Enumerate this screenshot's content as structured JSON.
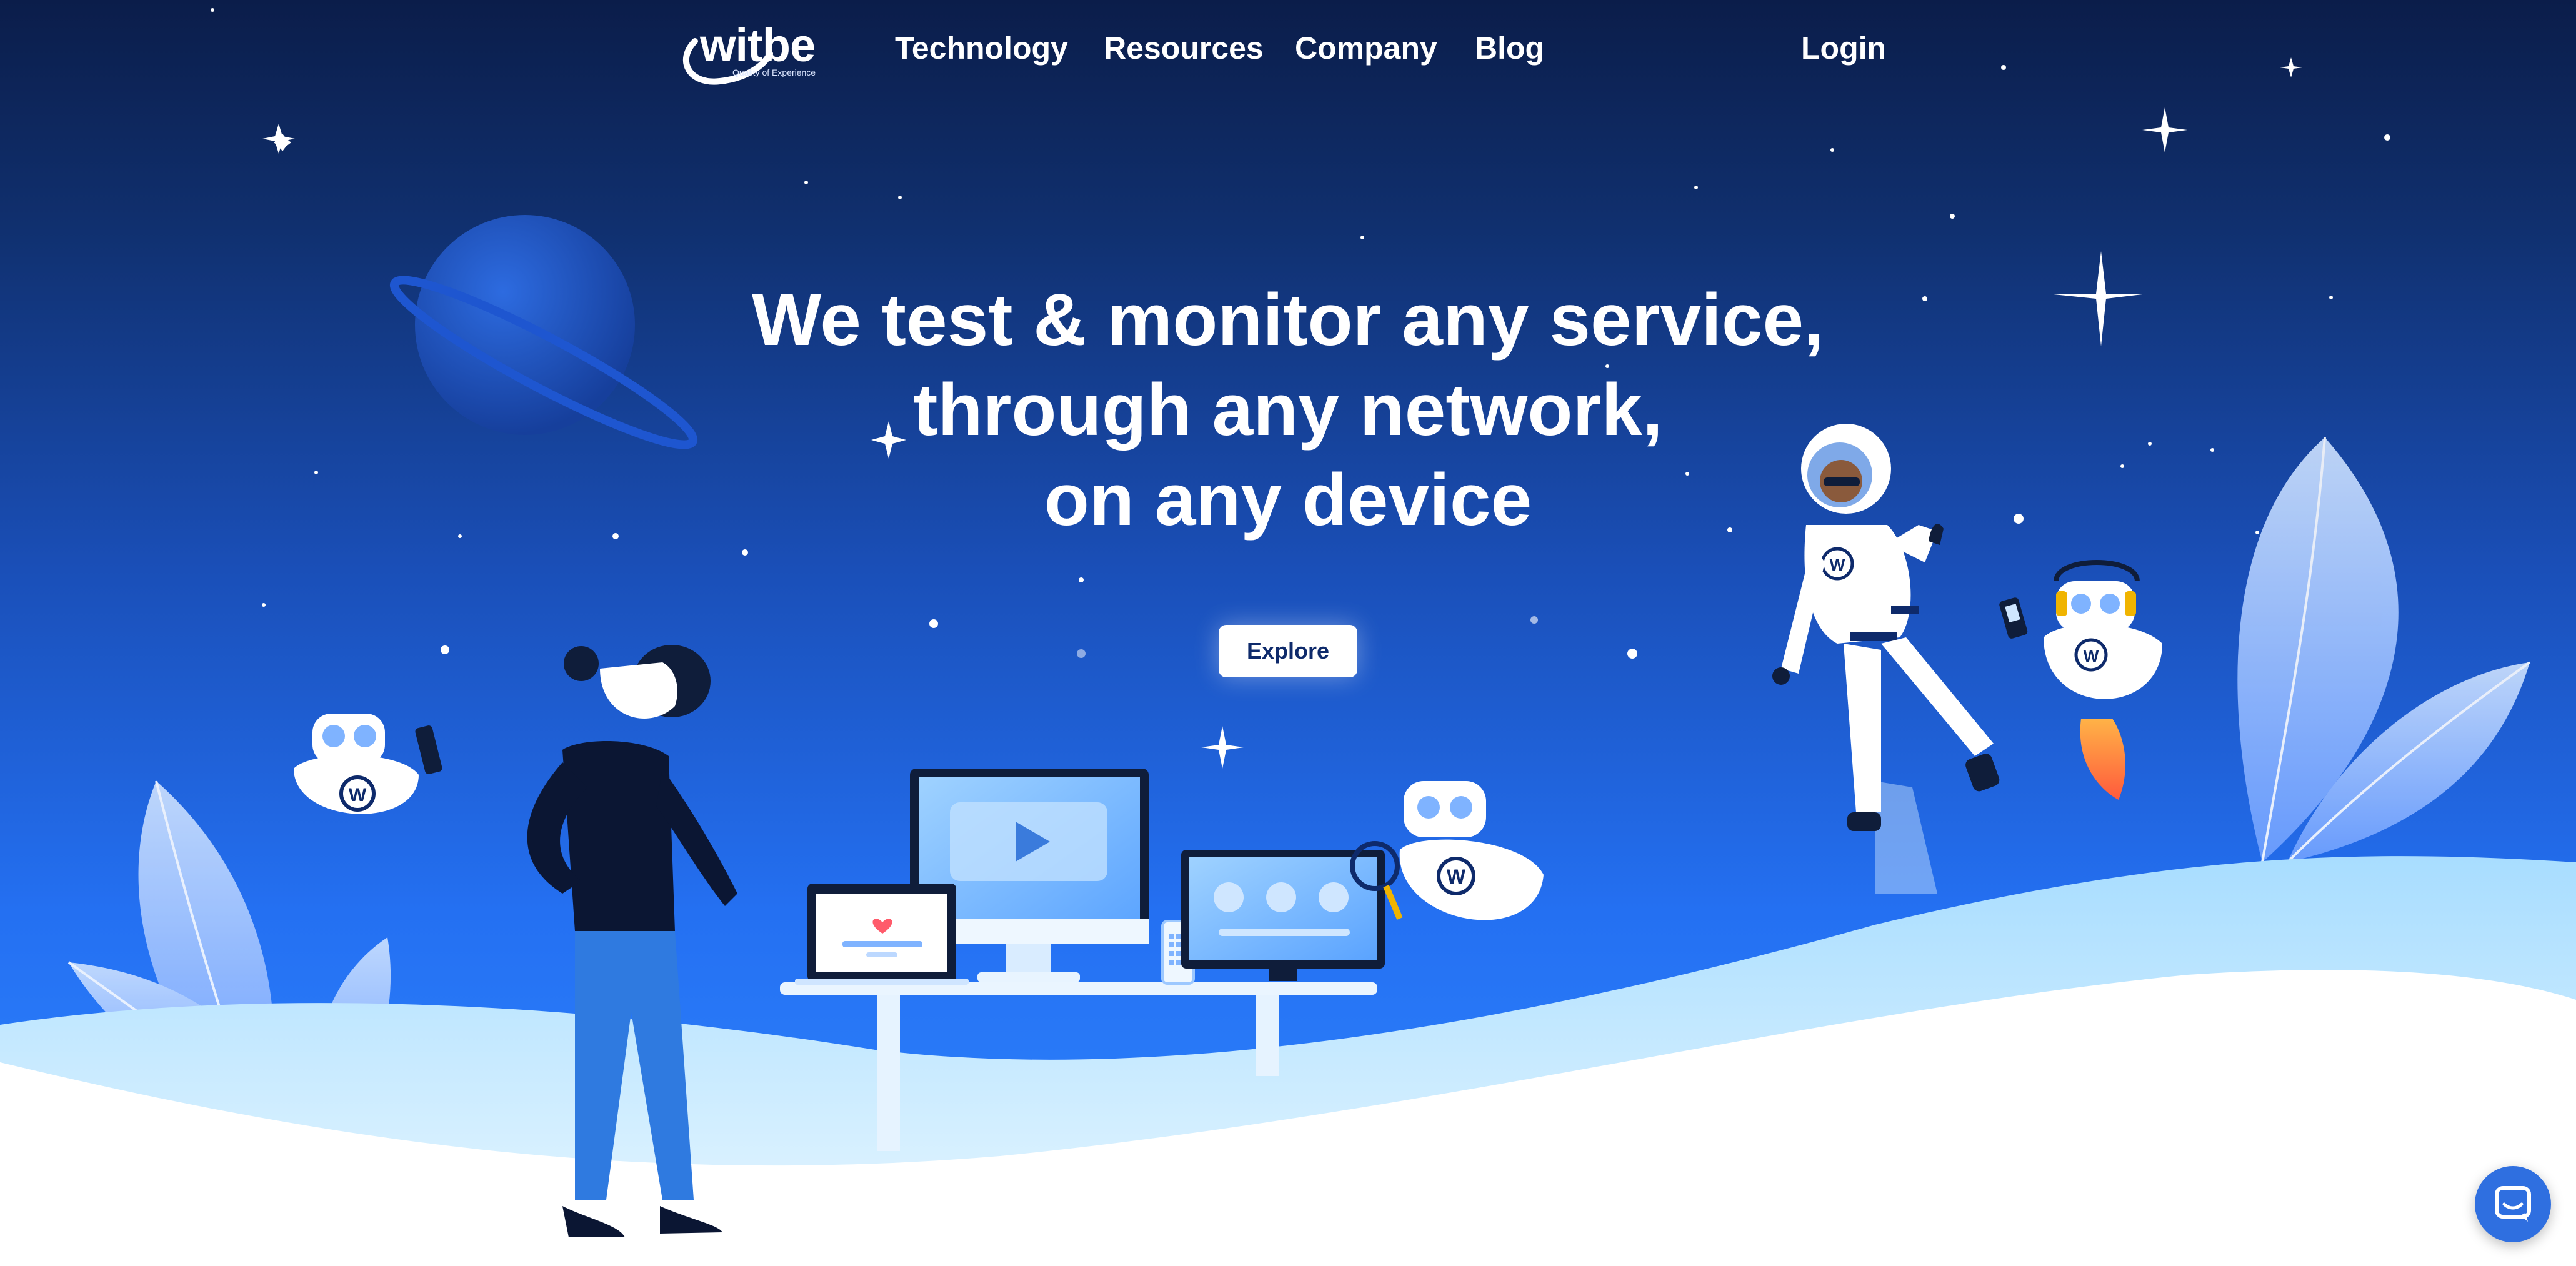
{
  "brand": {
    "name": "witbe",
    "tagline": "Quality of Experience"
  },
  "nav": {
    "items": [
      "Technology",
      "Resources",
      "Company",
      "Blog"
    ],
    "login": "Login"
  },
  "hero": {
    "lines": [
      "We test & monitor any service,",
      "through any network,",
      "on any device"
    ],
    "cta": "Explore"
  },
  "icons": {
    "chat": "chat-bubble-icon",
    "play": "play-icon",
    "heart": "heart-icon"
  },
  "colors": {
    "accent": "#2f6fe0",
    "navy": "#0e2a6b",
    "sky_top": "#0b1d4a",
    "sky_bottom": "#2f86ff",
    "ground": "#bfe7ff"
  }
}
